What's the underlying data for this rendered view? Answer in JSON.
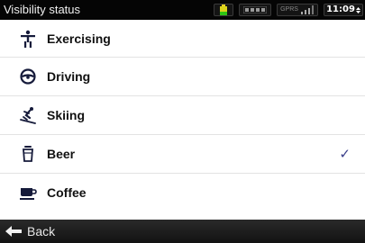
{
  "status_bar": {
    "title": "Visibility status",
    "gprs_text": "GPRS",
    "time": "11:09"
  },
  "list": {
    "items": [
      {
        "label": "Exercising",
        "icon": "exercising-icon",
        "selected": false
      },
      {
        "label": "Driving",
        "icon": "steering-wheel-icon",
        "selected": false
      },
      {
        "label": "Skiing",
        "icon": "skier-icon",
        "selected": false
      },
      {
        "label": "Beer",
        "icon": "beer-icon",
        "selected": true
      },
      {
        "label": "Coffee",
        "icon": "coffee-cup-icon",
        "selected": false
      }
    ],
    "check_glyph": "✓"
  },
  "bottom_bar": {
    "back_label": "Back"
  },
  "colors": {
    "status_bg": "#050505",
    "bottom_bg": "#1c1c1c",
    "check": "#3a3f8a",
    "divider": "#e3e3e3"
  }
}
